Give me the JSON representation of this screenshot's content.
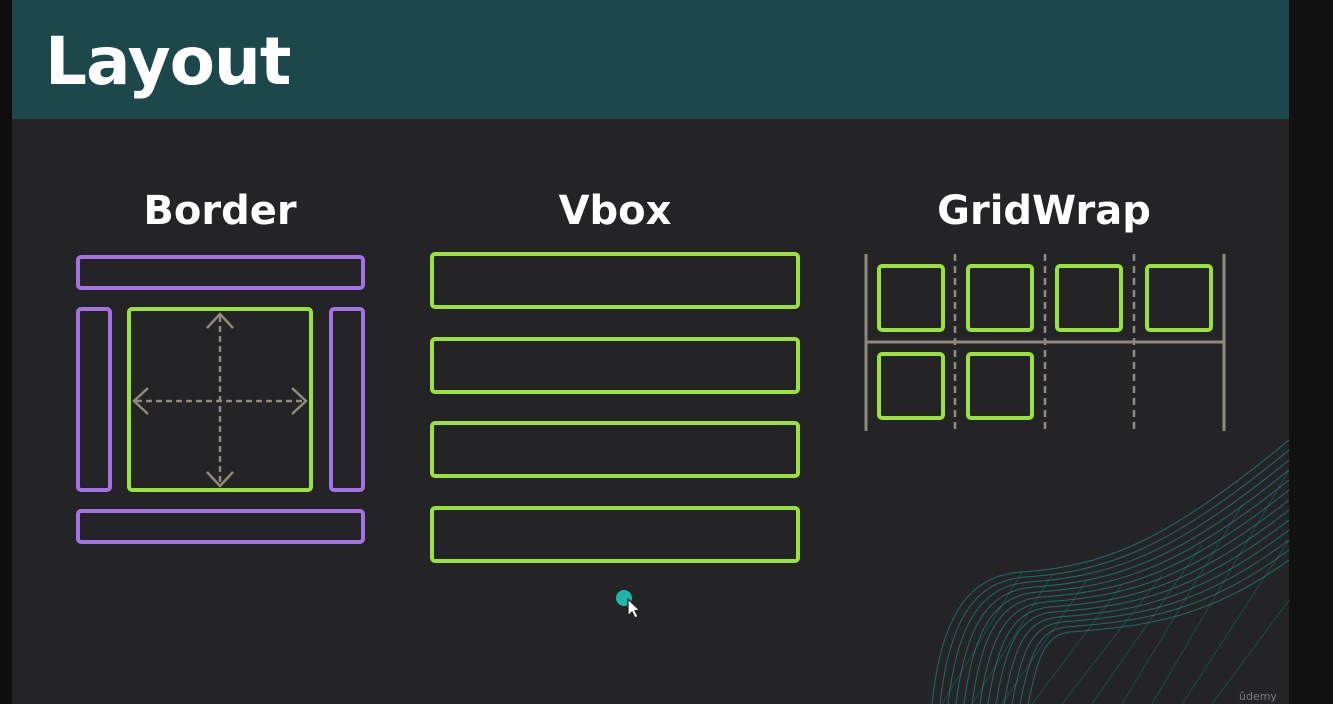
{
  "slide": {
    "title": "Layout",
    "sections": [
      {
        "id": "border",
        "label": "Border"
      },
      {
        "id": "vbox",
        "label": "Vbox"
      },
      {
        "id": "gridwrap",
        "label": "GridWrap"
      }
    ]
  },
  "watermark": "ûdemy",
  "colors": {
    "header": "#1c474b",
    "background": "#242326",
    "purple": "#a572e6",
    "green": "#9be13b",
    "gray": "#8e8a7c",
    "teal": "#1fb5a9"
  }
}
